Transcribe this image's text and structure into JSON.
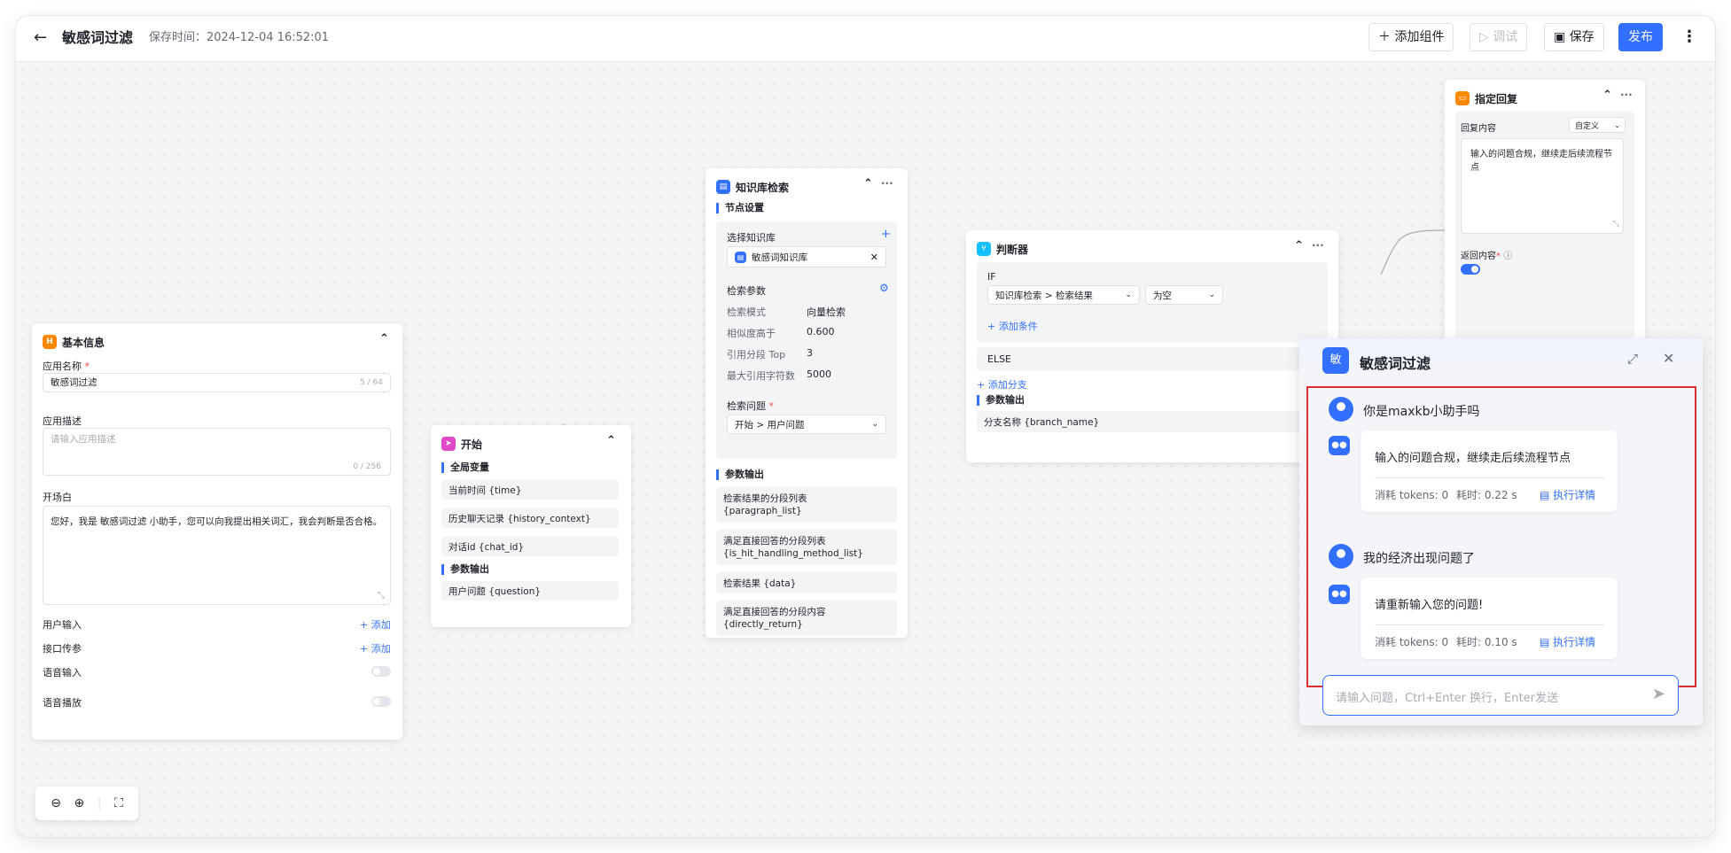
{
  "topbar": {
    "back": "←",
    "title": "敏感词过滤",
    "save_time": "保存时间：2024-12-04 16:52:01",
    "add_component": "添加组件",
    "debug": "调试",
    "save": "保存",
    "publish": "发布"
  },
  "basic": {
    "icon": "H",
    "title": "基本信息",
    "app_name_label": "应用名称",
    "app_name_value": "敏感词过滤",
    "app_name_count": "5 / 64",
    "desc_label": "应用描述",
    "desc_placeholder": "请输入应用描述",
    "desc_count": "0 / 256",
    "prologue_label": "开场白",
    "prologue_text": "您好，我是 敏感词过滤 小助手，您可以向我提出相关词汇，我会判断是否合格。",
    "user_input": "用户输入",
    "api_param": "接口传参",
    "add": "+ 添加",
    "voice_input": "语音输入",
    "voice_play": "语音播放"
  },
  "start": {
    "title": "开始",
    "global_vars": "全局变量",
    "vars": [
      "当前时间 {time}",
      "历史聊天记录 {history_context}",
      "对话id {chat_id}"
    ],
    "output_params": "参数输出",
    "outputs": [
      "用户问题 {question}"
    ]
  },
  "kb": {
    "title": "知识库检索",
    "node_settings": "节点设置",
    "select_kb": "选择知识库",
    "kb_name": "敏感词知识库",
    "search_params": "检索参数",
    "params": [
      {
        "k": "检索模式",
        "v": "向量检索"
      },
      {
        "k": "相似度高于",
        "v": "0.600"
      },
      {
        "k": "引用分段 Top",
        "v": "3"
      },
      {
        "k": "最大引用字符数",
        "v": "5000"
      }
    ],
    "question_label": "检索问题",
    "question_value": "开始 > 用户问题",
    "output_params": "参数输出",
    "outputs": [
      [
        "检索结果的分段列表",
        "{paragraph_list}"
      ],
      [
        "满足直接回答的分段列表",
        "{is_hit_handling_method_list}"
      ],
      [
        "检索结果 {data}"
      ],
      [
        "满足直接回答的分段内容",
        "{directly_return}"
      ]
    ]
  },
  "judge": {
    "title": "判断器",
    "if": "IF",
    "cond_field": "知识库检索 > 检索结果",
    "cond_op": "为空",
    "add_condition": "+ 添加条件",
    "else": "ELSE",
    "add_branch": "+ 添加分支",
    "output_params": "参数输出",
    "output": "分支名称 {branch_name}"
  },
  "reply": {
    "title": "指定回复",
    "content_label": "回复内容",
    "mode": "自定义",
    "content": "输入的问题合规，继续走后续流程节点",
    "return_label": "返回内容"
  },
  "chat": {
    "avatar": "敏",
    "title": "敏感词过滤",
    "messages": [
      {
        "question": "你是maxkb小助手吗",
        "answer": "输入的问题合规，继续走后续流程节点",
        "tokens": "消耗 tokens: 0",
        "time": "耗时: 0.22 s",
        "detail": "执行详情"
      },
      {
        "question": "我的经济出现问题了",
        "answer": "请重新输入您的问题!",
        "tokens": "消耗 tokens: 0",
        "time": "耗时: 0.10 s",
        "detail": "执行详情"
      }
    ],
    "input_placeholder": "请输入问题，Ctrl+Enter 换行，Enter发送"
  },
  "colors": {
    "primary": "#3370ff",
    "highlight_border": "#e03131"
  }
}
